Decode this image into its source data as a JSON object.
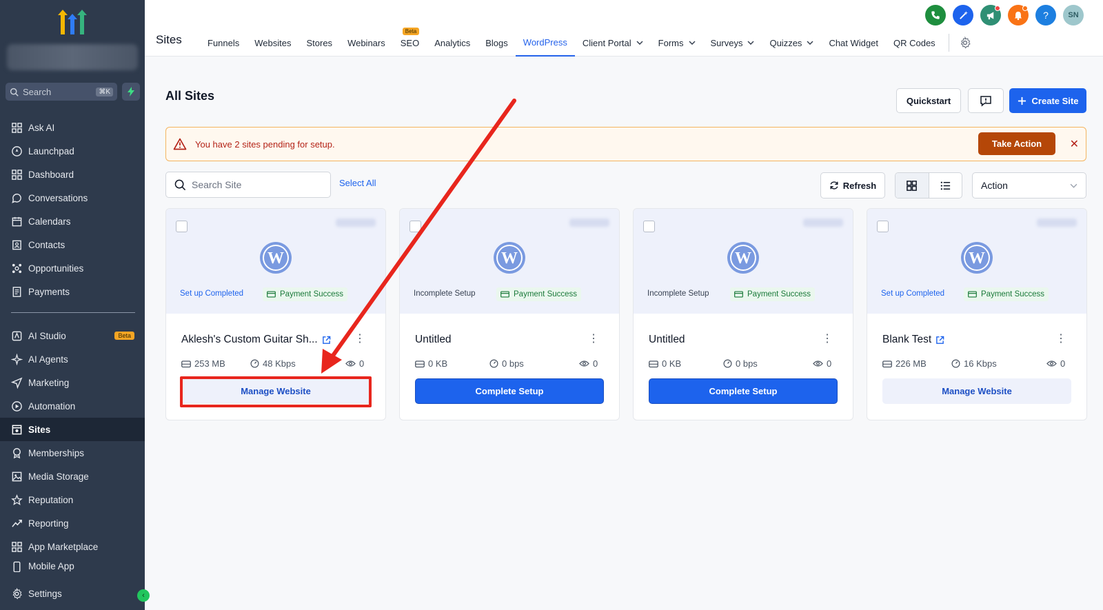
{
  "sidebar": {
    "search_label": "Search",
    "search_shortcut": "⌘K",
    "items_top": [
      {
        "label": "Ask AI",
        "icon": "grid-icon"
      },
      {
        "label": "Launchpad",
        "icon": "rocket-icon"
      },
      {
        "label": "Dashboard",
        "icon": "grid-icon"
      },
      {
        "label": "Conversations",
        "icon": "chat-icon"
      },
      {
        "label": "Calendars",
        "icon": "calendar-icon"
      },
      {
        "label": "Contacts",
        "icon": "contacts-icon"
      },
      {
        "label": "Opportunities",
        "icon": "opportunities-icon"
      },
      {
        "label": "Payments",
        "icon": "payments-icon"
      }
    ],
    "items_bottom": [
      {
        "label": "AI Studio",
        "icon": "ai-studio-icon",
        "badge": "Beta"
      },
      {
        "label": "AI Agents",
        "icon": "sparkle-icon"
      },
      {
        "label": "Marketing",
        "icon": "send-icon"
      },
      {
        "label": "Automation",
        "icon": "automation-icon"
      },
      {
        "label": "Sites",
        "icon": "sites-icon",
        "active": true
      },
      {
        "label": "Memberships",
        "icon": "memberships-icon"
      },
      {
        "label": "Media Storage",
        "icon": "image-icon"
      },
      {
        "label": "Reputation",
        "icon": "star-icon"
      },
      {
        "label": "Reporting",
        "icon": "trend-icon"
      },
      {
        "label": "App Marketplace",
        "icon": "grid-icon"
      },
      {
        "label": "Mobile App",
        "icon": "mobile-icon"
      }
    ],
    "settings_label": "Settings"
  },
  "topnav": {
    "title": "Sites",
    "tabs": [
      {
        "label": "Funnels"
      },
      {
        "label": "Websites"
      },
      {
        "label": "Stores"
      },
      {
        "label": "Webinars"
      },
      {
        "label": "SEO",
        "badge": "Beta"
      },
      {
        "label": "Analytics"
      },
      {
        "label": "Blogs"
      },
      {
        "label": "WordPress",
        "active": true
      },
      {
        "label": "Client Portal",
        "dropdown": true
      },
      {
        "label": "Forms",
        "dropdown": true
      },
      {
        "label": "Surveys",
        "dropdown": true
      },
      {
        "label": "Quizzes",
        "dropdown": true
      },
      {
        "label": "Chat Widget"
      },
      {
        "label": "QR Codes"
      }
    ],
    "avatar_initials": "SN",
    "icon_colors": {
      "phone": "#1e8e3e",
      "magic": "#1d63ed",
      "announce": "#2f8f74",
      "bell": "#f97316",
      "help": "#1d7fe0"
    }
  },
  "main": {
    "title": "All Sites",
    "quickstart_label": "Quickstart",
    "create_site_label": "Create Site",
    "alert_text": "You have 2 sites pending for setup.",
    "take_action_label": "Take Action",
    "search_placeholder": "Search Site",
    "select_all_label": "Select All",
    "refresh_label": "Refresh",
    "action_label": "Action"
  },
  "cards": [
    {
      "status": "Set up Completed",
      "status_type": "done",
      "payment": "Payment Success",
      "name": "Aklesh's Custom Guitar Sh...",
      "external_link": true,
      "storage": "253 MB",
      "bandwidth": "48 Kbps",
      "views": "0",
      "button": "Manage Website",
      "button_type": "manage"
    },
    {
      "status": "Incomplete Setup",
      "status_type": "incomplete",
      "payment": "Payment Success",
      "name": "Untitled",
      "external_link": false,
      "storage": "0 KB",
      "bandwidth": "0 bps",
      "views": "0",
      "button": "Complete Setup",
      "button_type": "complete"
    },
    {
      "status": "Incomplete Setup",
      "status_type": "incomplete",
      "payment": "Payment Success",
      "name": "Untitled",
      "external_link": false,
      "storage": "0 KB",
      "bandwidth": "0 bps",
      "views": "0",
      "button": "Complete Setup",
      "button_type": "complete"
    },
    {
      "status": "Set up Completed",
      "status_type": "done",
      "payment": "Payment Success",
      "name": "Blank Test",
      "external_link": true,
      "storage": "226 MB",
      "bandwidth": "16 Kbps",
      "views": "0",
      "button": "Manage Website",
      "button_type": "manage"
    }
  ],
  "annotation": {
    "color": "#e8261d",
    "target": "Manage Website"
  }
}
